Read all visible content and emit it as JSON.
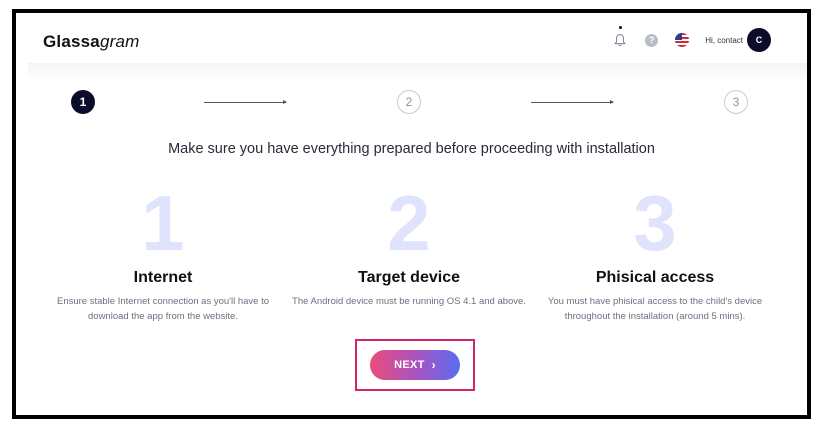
{
  "header": {
    "logo_bold": "Glassa",
    "logo_italic": "gram",
    "help_glyph": "?",
    "greeting": "Hi, contact",
    "avatar_initial": "C"
  },
  "stepper": {
    "steps": [
      {
        "label": "1",
        "state": "active"
      },
      {
        "label": "2",
        "state": "idle"
      },
      {
        "label": "3",
        "state": "idle"
      }
    ]
  },
  "main": {
    "heading": "Make sure you have everything prepared before proceeding with installation",
    "requirements": [
      {
        "number": "1",
        "title": "Internet",
        "description": "Ensure stable Internet connection as you'll have to download the app from the website."
      },
      {
        "number": "2",
        "title": "Target device",
        "description": "The Android device must be running OS 4.1 and above."
      },
      {
        "number": "3",
        "title": "Phisical access",
        "description": "You must have phisical access to the child's device throughout the installation (around 5 mins)."
      }
    ]
  },
  "actions": {
    "next_label": "NEXT",
    "next_chevron": "›"
  },
  "colors": {
    "accent_dark": "#0b0b2a",
    "button_gradient_start": "#ea4c7b",
    "button_gradient_end": "#5a6cf0",
    "highlight_border": "#d2236b",
    "big_number": "#dfe3fb"
  },
  "icons": [
    "bell-icon",
    "help-icon",
    "us-flag-icon",
    "chevron-right-icon"
  ]
}
